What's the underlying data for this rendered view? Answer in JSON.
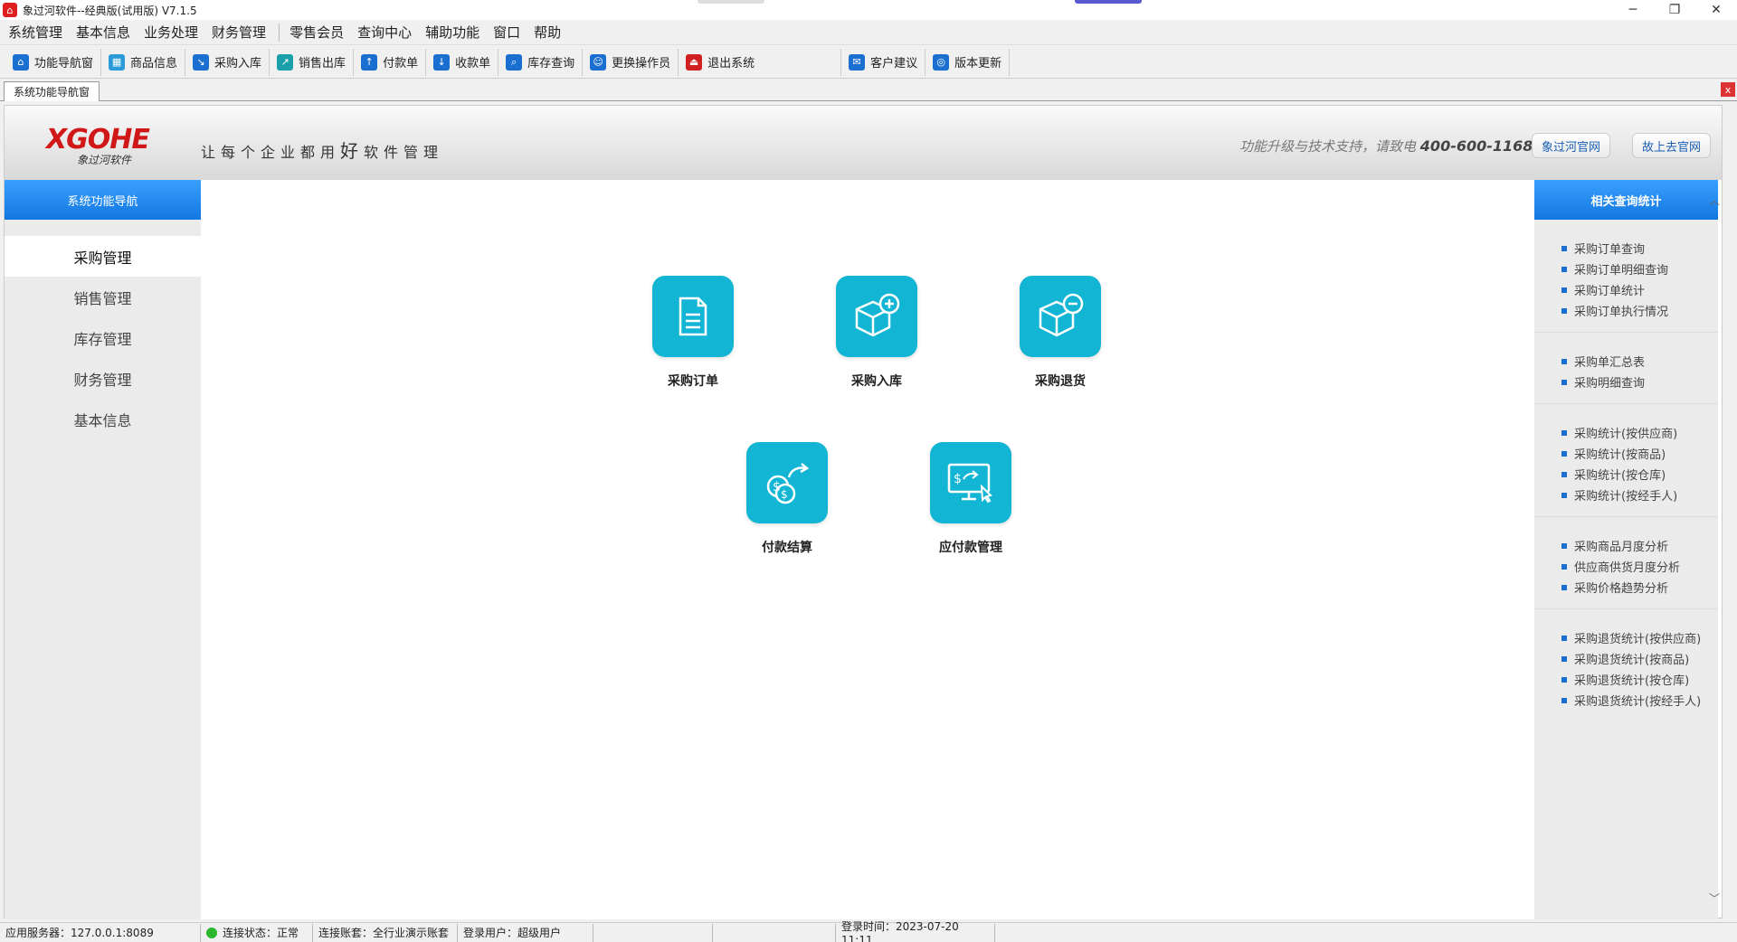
{
  "window": {
    "title": "象过河软件--经典版(试用版) V7.1.5",
    "minimize": "─",
    "maximize": "❐",
    "close": "✕"
  },
  "menu": [
    "系统管理",
    "基本信息",
    "业务处理",
    "财务管理",
    "零售会员",
    "查询中心",
    "辅助功能",
    "窗口",
    "帮助"
  ],
  "toolbar": [
    {
      "label": "功能导航窗",
      "icon": "home-icon",
      "color": "#1a6fd0"
    },
    {
      "label": "商品信息",
      "icon": "product-info-icon",
      "color": "#2a9ad8"
    },
    {
      "label": "采购入库",
      "icon": "purchase-in-icon",
      "color": "#1a6fd0"
    },
    {
      "label": "销售出库",
      "icon": "sales-out-icon",
      "color": "#1aa0a8"
    },
    {
      "label": "付款单",
      "icon": "payment-icon",
      "color": "#1a6fd0"
    },
    {
      "label": "收款单",
      "icon": "receipt-icon",
      "color": "#1a6fd0"
    },
    {
      "label": "库存查询",
      "icon": "inventory-search-icon",
      "color": "#1a6fd0"
    },
    {
      "label": "更换操作员",
      "icon": "switch-user-icon",
      "color": "#1a6fd0"
    },
    {
      "label": "退出系统",
      "icon": "exit-icon",
      "color": "#d02020"
    },
    {
      "label": "客户建议",
      "icon": "feedback-icon",
      "color": "#1a6fd0"
    },
    {
      "label": "版本更新",
      "icon": "update-globe-icon",
      "color": "#1a6fd0"
    }
  ],
  "tab": {
    "label": "系统功能导航窗",
    "close": "x"
  },
  "banner": {
    "logo_mark": "XGOHE",
    "logo_sub": "象过河软件",
    "slogan_pre": "让每个企业都用",
    "slogan_bold": "好",
    "slogan_post": "软件管理",
    "support_text": "功能升级与技术支持，请致电",
    "support_phone": "400-600-1168",
    "btn_site": "象过河官网",
    "btn_go": "故上去官网"
  },
  "leftnav": {
    "header": "系统功能导航",
    "items": [
      "采购管理",
      "销售管理",
      "库存管理",
      "财务管理",
      "基本信息"
    ]
  },
  "functions": [
    {
      "label": "采购订单",
      "icon": "document-icon"
    },
    {
      "label": "采购入库",
      "icon": "box-plus-icon"
    },
    {
      "label": "采购退货",
      "icon": "box-minus-icon"
    },
    {
      "label": "付款结算",
      "icon": "coins-transfer-icon"
    },
    {
      "label": "应付款管理",
      "icon": "monitor-payment-icon"
    }
  ],
  "rightpanel": {
    "header": "相关查询统计",
    "groups": [
      [
        "采购订单查询",
        "采购订单明细查询",
        "采购订单统计",
        "采购订单执行情况"
      ],
      [
        "采购单汇总表",
        "采购明细查询"
      ],
      [
        "采购统计(按供应商)",
        "采购统计(按商品)",
        "采购统计(按仓库)",
        "采购统计(按经手人)"
      ],
      [
        "采购商品月度分析",
        "供应商供货月度分析",
        "采购价格趋势分析"
      ],
      [
        "采购退货统计(按供应商)",
        "采购退货统计(按商品)",
        "采购退货统计(按仓库)",
        "采购退货统计(按经手人)"
      ]
    ]
  },
  "status": {
    "server": "应用服务器：127.0.0.1:8089",
    "conn": "连接状态：正常",
    "account": "连接账套：全行业演示账套",
    "user": "登录用户：超级用户",
    "login_time": "登录时间：2023-07-20 11:11"
  },
  "colors": {
    "accent": "#1277e0",
    "tile": "#12b5d4",
    "logo": "#d01818"
  }
}
